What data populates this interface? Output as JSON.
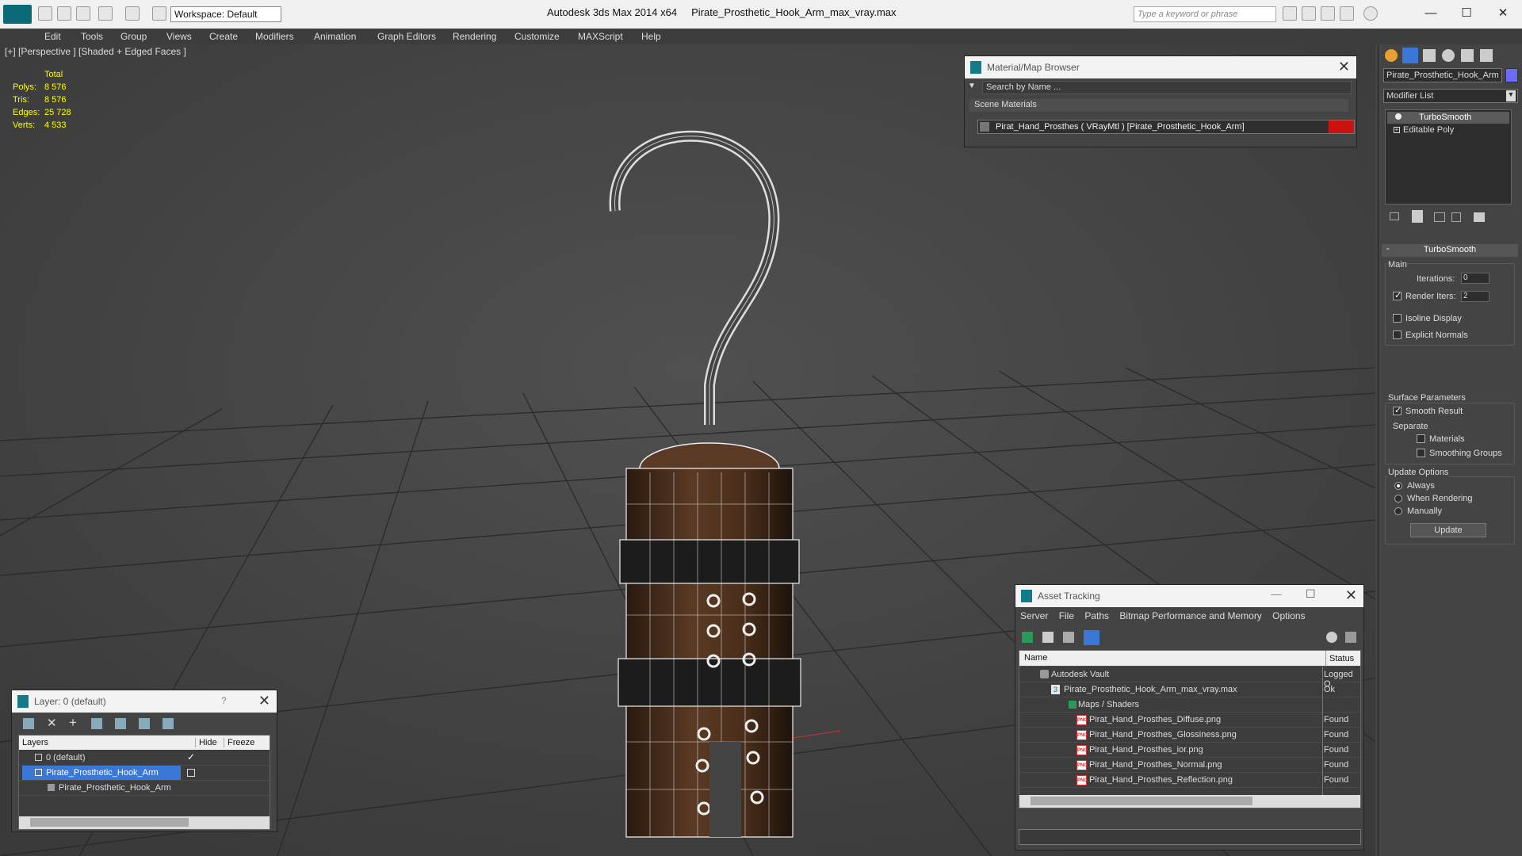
{
  "app": {
    "title": "Autodesk 3ds Max  2014 x64",
    "file": "Pirate_Prosthetic_Hook_Arm_max_vray.max",
    "workspace": "Workspace: Default",
    "search_placeholder": "Type a keyword or phrase"
  },
  "menu": [
    "Edit",
    "Tools",
    "Group",
    "Views",
    "Create",
    "Modifiers",
    "Animation",
    "Graph Editors",
    "Rendering",
    "Customize",
    "MAXScript",
    "Help"
  ],
  "viewport": {
    "label": "[+] [Perspective ] [Shaded + Edged Faces ]",
    "stats_header": "Total",
    "stats": [
      {
        "label": "Polys:",
        "value": "8 576"
      },
      {
        "label": "Tris:",
        "value": "8 576"
      },
      {
        "label": "Edges:",
        "value": "25 728"
      },
      {
        "label": "Verts:",
        "value": "4 533"
      }
    ]
  },
  "material_browser": {
    "title": "Material/Map Browser",
    "search": "Search by Name ...",
    "section": "Scene Materials",
    "item": "Pirat_Hand_Prosthes  ( VRayMtl ) [Pirate_Prosthetic_Hook_Arm]"
  },
  "asset_tracking": {
    "title": "Asset Tracking",
    "menu": [
      "Server",
      "File",
      "Paths",
      "Bitmap Performance and Memory",
      "Options"
    ],
    "col_name": "Name",
    "col_status": "Status",
    "rows": [
      {
        "name": "Autodesk Vault",
        "status": "Logged O"
      },
      {
        "name": "Pirate_Prosthetic_Hook_Arm_max_vray.max",
        "status": "Ok"
      },
      {
        "name": "Maps / Shaders",
        "status": ""
      },
      {
        "name": "Pirat_Hand_Prosthes_Diffuse.png",
        "status": "Found"
      },
      {
        "name": "Pirat_Hand_Prosthes_Glossiness.png",
        "status": "Found"
      },
      {
        "name": "Pirat_Hand_Prosthes_ior.png",
        "status": "Found"
      },
      {
        "name": "Pirat_Hand_Prosthes_Normal.png",
        "status": "Found"
      },
      {
        "name": "Pirat_Hand_Prosthes_Reflection.png",
        "status": "Found"
      }
    ]
  },
  "layers": {
    "title": "Layer: 0 (default)",
    "help": "?",
    "col_layers": "Layers",
    "col_hide": "Hide",
    "col_freeze": "Freeze",
    "rows": [
      "0 (default)",
      "Pirate_Prosthetic_Hook_Arm",
      "Pirate_Prosthetic_Hook_Arm"
    ]
  },
  "command_panel": {
    "object_name": "Pirate_Prosthetic_Hook_Arm",
    "modifier_list": "Modifier List",
    "stack": [
      "TurboSmooth",
      "Editable Poly"
    ],
    "rollout": "TurboSmooth",
    "main": "Main",
    "iterations_label": "Iterations:",
    "iterations": "0",
    "render_iters_label": "Render Iters:",
    "render_iters": "2",
    "isoline": "Isoline Display",
    "explicit": "Explicit Normals",
    "surface": "Surface Parameters",
    "smooth_result": "Smooth Result",
    "separate": "Separate",
    "materials": "Materials",
    "smoothing_groups": "Smoothing Groups",
    "update_options": "Update Options",
    "always": "Always",
    "when_rendering": "When Rendering",
    "manually": "Manually",
    "update_btn": "Update"
  },
  "colors": {
    "accent": "#3a78d8",
    "object_color": "#6b6bff",
    "mat_swatch": "#cc1111"
  }
}
